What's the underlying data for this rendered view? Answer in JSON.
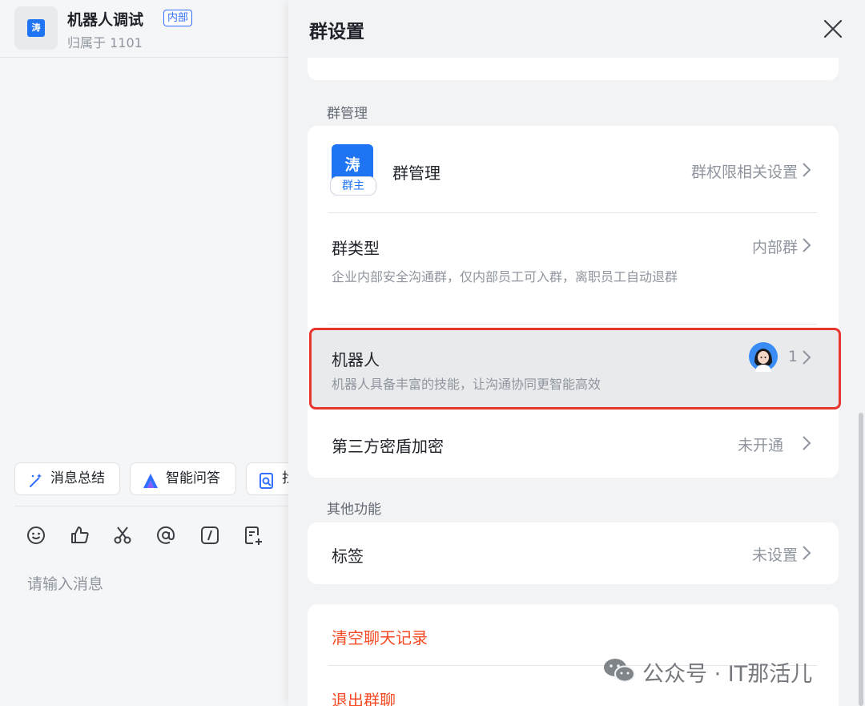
{
  "chat": {
    "avatar_char": "涛",
    "title": "机器人调试",
    "badge": "内部",
    "subtitle": "归属于 1101",
    "quick_actions": [
      {
        "label": "消息总结",
        "icon": "magic-wand-icon"
      },
      {
        "label": "智能问答",
        "icon": "ai-logo-icon"
      },
      {
        "label": "找",
        "icon": "doc-search-icon"
      }
    ],
    "toolbar_icons": [
      "emoji-icon",
      "thumbs-up-icon",
      "scissors-icon",
      "at-icon",
      "slash-command-icon",
      "doc-plus-icon"
    ],
    "input_placeholder": "请输入消息"
  },
  "panel": {
    "title": "群设置",
    "sections": {
      "group_manage_label": "群管理",
      "other_label": "其他功能"
    },
    "group_admin": {
      "avatar_char": "涛",
      "owner_tag": "群主",
      "title": "群管理",
      "value": "群权限相关设置"
    },
    "group_type": {
      "title": "群类型",
      "value": "内部群",
      "desc": "企业内部安全沟通群，仅内部员工可入群，离职员工自动退群"
    },
    "bots": {
      "title": "机器人",
      "count": "1",
      "desc": "机器人具备丰富的技能，让沟通协同更智能高效"
    },
    "encryption": {
      "title": "第三方密盾加密",
      "value": "未开通"
    },
    "tags": {
      "title": "标签",
      "value": "未设置"
    },
    "clear_history": "清空聊天记录",
    "leave_group": "退出群聊"
  },
  "watermark": "公众号 · IT那活儿",
  "colors": {
    "accent": "#1e74f2",
    "danger": "#f54a23",
    "highlight_border": "#e8352d"
  }
}
